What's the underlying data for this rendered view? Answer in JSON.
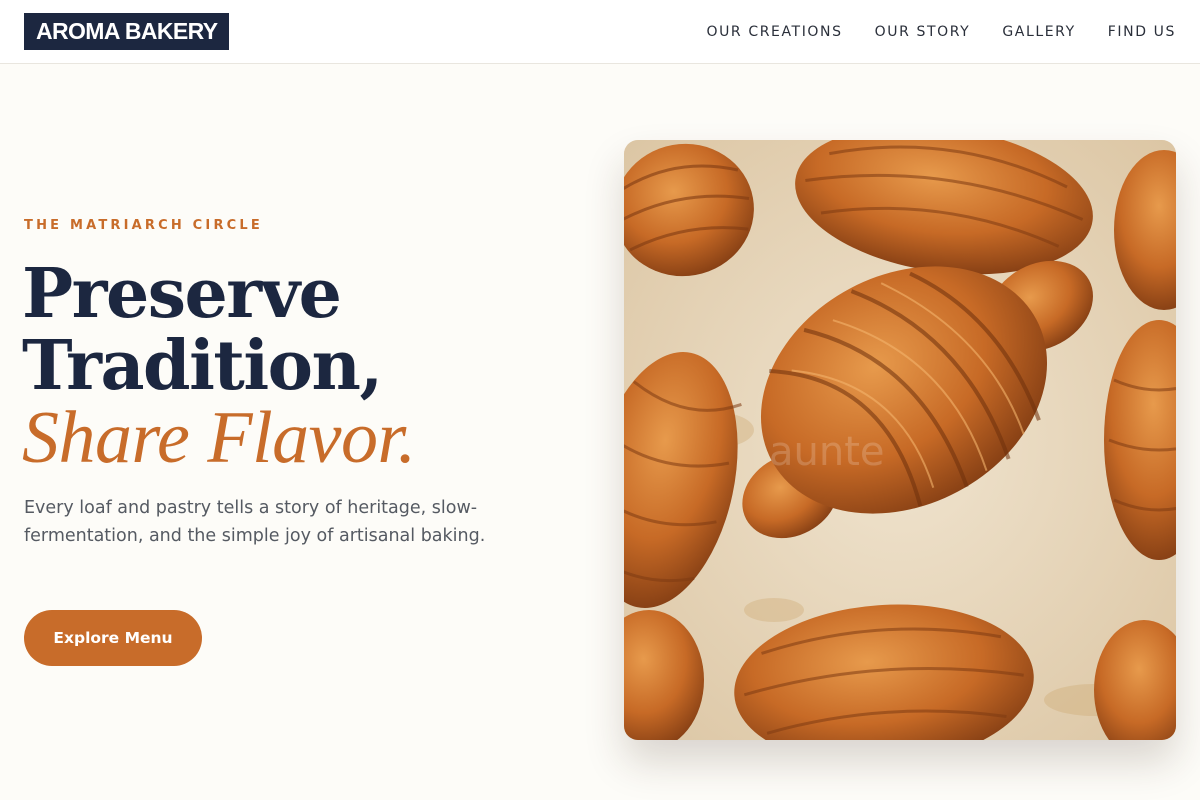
{
  "brand": {
    "name": "AROMA BAKERY"
  },
  "nav": {
    "items": [
      {
        "label": "OUR CREATIONS"
      },
      {
        "label": "OUR STORY"
      },
      {
        "label": "GALLERY"
      },
      {
        "label": "FIND US"
      }
    ]
  },
  "hero": {
    "eyebrow": "THE MATRIARCH CIRCLE",
    "headline_line1": "Preserve",
    "headline_line2": "Tradition,",
    "headline_accent": "Share Flavor.",
    "description": "Every loaf and pastry tells a story of heritage, slow-fermentation, and the simple joy of artisanal baking.",
    "cta_label": "Explore Menu"
  },
  "colors": {
    "brand_dark": "#1c2740",
    "accent": "#c86c2a",
    "background": "#fdfcf8"
  },
  "image": {
    "subject": "croissants-on-parchment",
    "watermark": "aunte"
  }
}
